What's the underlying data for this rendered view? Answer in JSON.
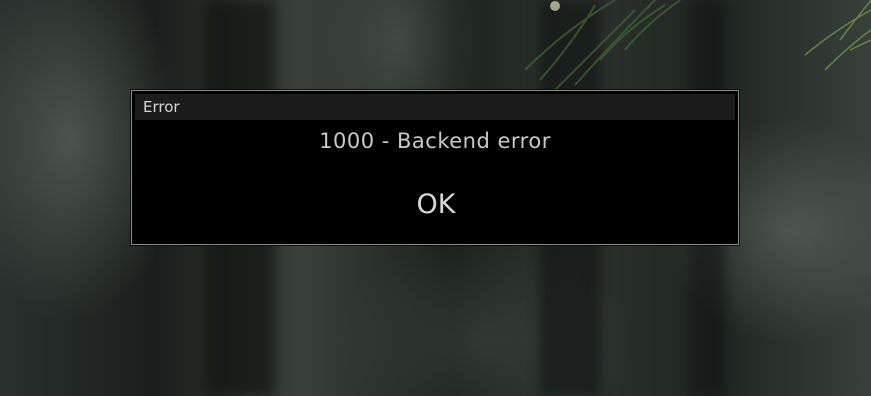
{
  "dialog": {
    "title": "Error",
    "message": "1000 - Backend error",
    "ok_label": "OK"
  },
  "colors": {
    "dialog_background": "#000000",
    "title_bar_background": "#1c1c1c",
    "border": "#8d8d8d",
    "text": "#c9c9c9"
  }
}
